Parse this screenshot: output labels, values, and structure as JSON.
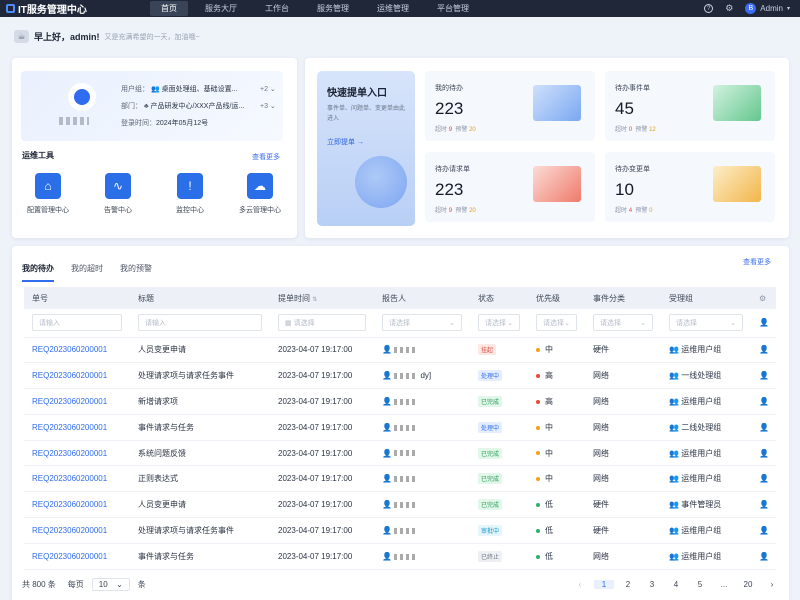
{
  "app": {
    "title": "IT服务管理中心"
  },
  "nav": [
    "首页",
    "服务大厅",
    "工作台",
    "服务管理",
    "运维管理",
    "平台管理"
  ],
  "topright": {
    "help": "?",
    "settings": "⚙",
    "avatar_letter": "B",
    "user": "Admin"
  },
  "greeting": {
    "title": "早上好，admin!",
    "subtitle": "又是充满希望的一天，加油哦~"
  },
  "profile": {
    "roles_label": "用户组：",
    "roles_value": "桌面处理组、基础设置...",
    "roles_more": "+2",
    "dept_label": "部门：",
    "dept_value": "产品研发中心/XXX产品线/运...",
    "dept_more": "+3",
    "login_label": "登录时间：",
    "login_value": "2024年05月12号"
  },
  "tools": {
    "title": "运维工具",
    "more": "查看更多",
    "items": [
      {
        "label": "配置管理中心",
        "icon": "⌂"
      },
      {
        "label": "告警中心",
        "icon": "∿"
      },
      {
        "label": "监控中心",
        "icon": "!"
      },
      {
        "label": "多云管理中心",
        "icon": "☁"
      }
    ]
  },
  "quick": {
    "title": "快速提单入口",
    "desc": "事件单、问题单、变更单由此进入",
    "link": "立即提单 →"
  },
  "stats": [
    {
      "label": "我的待办",
      "value": "223",
      "overdue_label": "超时",
      "overdue": "9",
      "warn_label": "预警",
      "warn": "20",
      "color": "#4a8cf0"
    },
    {
      "label": "待办事件单",
      "value": "45",
      "overdue_label": "超时",
      "overdue": "0",
      "warn_label": "预警",
      "warn": "12",
      "color": "#3fbf78"
    },
    {
      "label": "待办请求单",
      "value": "223",
      "overdue_label": "超时",
      "overdue": "9",
      "warn_label": "预警",
      "warn": "20",
      "color": "#ef6a5a"
    },
    {
      "label": "待办变更单",
      "value": "10",
      "overdue_label": "超时",
      "overdue": "4",
      "warn_label": "预警",
      "warn": "0",
      "color": "#f2b33d"
    }
  ],
  "tabs": {
    "items": [
      "我的待办",
      "我的超时",
      "我的预警"
    ],
    "more": "查看更多"
  },
  "table": {
    "columns": [
      "单号",
      "标题",
      "提单时间",
      "报告人",
      "状态",
      "优先级",
      "事件分类",
      "受理组"
    ],
    "filters": [
      "请输入",
      "请输入",
      "请选择",
      "请选择",
      "请选择",
      "请选择",
      "请选择",
      "请选择"
    ],
    "rows": [
      {
        "id": "REQ2023060200001",
        "title": "人员变更申请",
        "time": "2023-04-07 19:17:00",
        "reporter": "",
        "status": "挂起",
        "priority": "中",
        "category": "硬件",
        "group": "运维用户组"
      },
      {
        "id": "REQ2023060200001",
        "title": "处理请求项与请求任务事件",
        "time": "2023-04-07 19:17:00",
        "reporter": "dy]",
        "status": "处理中",
        "priority": "高",
        "category": "网络",
        "group": "一线处理组"
      },
      {
        "id": "REQ2023060200001",
        "title": "新增请求项",
        "time": "2023-04-07 19:17:00",
        "reporter": "",
        "status": "已完成",
        "priority": "高",
        "category": "网络",
        "group": "运维用户组"
      },
      {
        "id": "REQ2023060200001",
        "title": "事件请求与任务",
        "time": "2023-04-07 19:17:00",
        "reporter": "",
        "status": "处理中",
        "priority": "中",
        "category": "网络",
        "group": "二线处理组"
      },
      {
        "id": "REQ2023060200001",
        "title": "系统问题反馈",
        "time": "2023-04-07 19:17:00",
        "reporter": "",
        "status": "已完成",
        "priority": "中",
        "category": "网络",
        "group": "运维用户组"
      },
      {
        "id": "REQ2023060200001",
        "title": "正则表达式",
        "time": "2023-04-07 19:17:00",
        "reporter": "",
        "status": "已完成",
        "priority": "中",
        "category": "网络",
        "group": "运维用户组"
      },
      {
        "id": "REQ2023060200001",
        "title": "人员变更申请",
        "time": "2023-04-07 19:17:00",
        "reporter": "",
        "status": "已完成",
        "priority": "低",
        "category": "硬件",
        "group": "事件管理员"
      },
      {
        "id": "REQ2023060200001",
        "title": "处理请求项与请求任务事件",
        "time": "2023-04-07 19:17:00",
        "reporter": "",
        "status": "审批中",
        "priority": "低",
        "category": "硬件",
        "group": "运维用户组"
      },
      {
        "id": "REQ2023060200001",
        "title": "事件请求与任务",
        "time": "2023-04-07 19:17:00",
        "reporter": "",
        "status": "已终止",
        "priority": "低",
        "category": "网络",
        "group": "运维用户组"
      }
    ]
  },
  "pager": {
    "total": "共 800 条",
    "per_page_label": "每页",
    "per_page": "10",
    "unit": "条",
    "pages": [
      "1",
      "2",
      "3",
      "4",
      "5",
      "...",
      "20"
    ],
    "prev": "‹",
    "next": "›"
  },
  "status_colors": {
    "挂起": [
      "#fde8e6",
      "#e0483a"
    ],
    "处理中": [
      "#e4eefe",
      "#2f6cf0"
    ],
    "已完成": [
      "#e3f6ea",
      "#2aa05a"
    ],
    "审批中": [
      "#e4f5fb",
      "#1f96c7"
    ],
    "已终止": [
      "#eef0f3",
      "#6d7686"
    ]
  },
  "priority_colors": {
    "高": "#e5493a",
    "中": "#f0a31a",
    "低": "#2fb06a"
  }
}
